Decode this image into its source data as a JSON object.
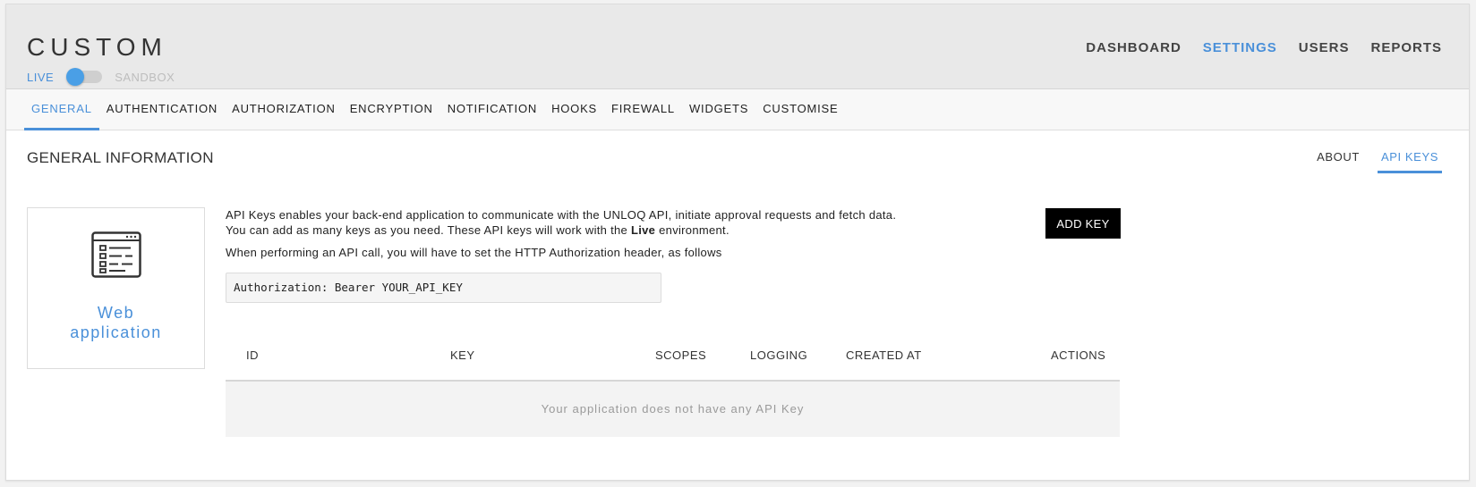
{
  "header": {
    "title": "CUSTOM",
    "env_live": "LIVE",
    "env_sandbox": "SANDBOX",
    "nav": [
      {
        "label": "DASHBOARD",
        "active": false
      },
      {
        "label": "SETTINGS",
        "active": true
      },
      {
        "label": "USERS",
        "active": false
      },
      {
        "label": "REPORTS",
        "active": false
      }
    ]
  },
  "subnav": {
    "items": [
      {
        "label": "GENERAL",
        "active": true
      },
      {
        "label": "AUTHENTICATION",
        "active": false
      },
      {
        "label": "AUTHORIZATION",
        "active": false
      },
      {
        "label": "ENCRYPTION",
        "active": false
      },
      {
        "label": "NOTIFICATION",
        "active": false
      },
      {
        "label": "HOOKS",
        "active": false
      },
      {
        "label": "FIREWALL",
        "active": false
      },
      {
        "label": "WIDGETS",
        "active": false
      },
      {
        "label": "CUSTOMISE",
        "active": false
      }
    ]
  },
  "section": {
    "title": "GENERAL INFORMATION",
    "tabs": [
      {
        "label": "ABOUT",
        "active": false
      },
      {
        "label": "API KEYS",
        "active": true
      }
    ]
  },
  "app_card": {
    "icon": "application-form-icon",
    "label_line1": "Web",
    "label_line2": "application"
  },
  "api_keys": {
    "desc_line1": "API Keys enables your back-end application to communicate with the UNLOQ API, initiate approval requests and fetch data.",
    "desc_line2_pre": "You can add as many keys as you need. These API keys will work with the ",
    "desc_line2_bold": "Live",
    "desc_line2_post": " environment.",
    "desc_line3": "When performing an API call, you will have to set the HTTP Authorization header, as follows",
    "code_sample": "Authorization: Bearer YOUR_API_KEY",
    "add_button": "ADD KEY",
    "table": {
      "columns": [
        "ID",
        "KEY",
        "SCOPES",
        "LOGGING",
        "CREATED AT",
        "ACTIONS"
      ],
      "empty_message": "Your application does not have any API Key"
    }
  },
  "colors": {
    "accent": "#4a90d9",
    "header_bg": "#e9e9e9",
    "button_bg": "#000000"
  }
}
